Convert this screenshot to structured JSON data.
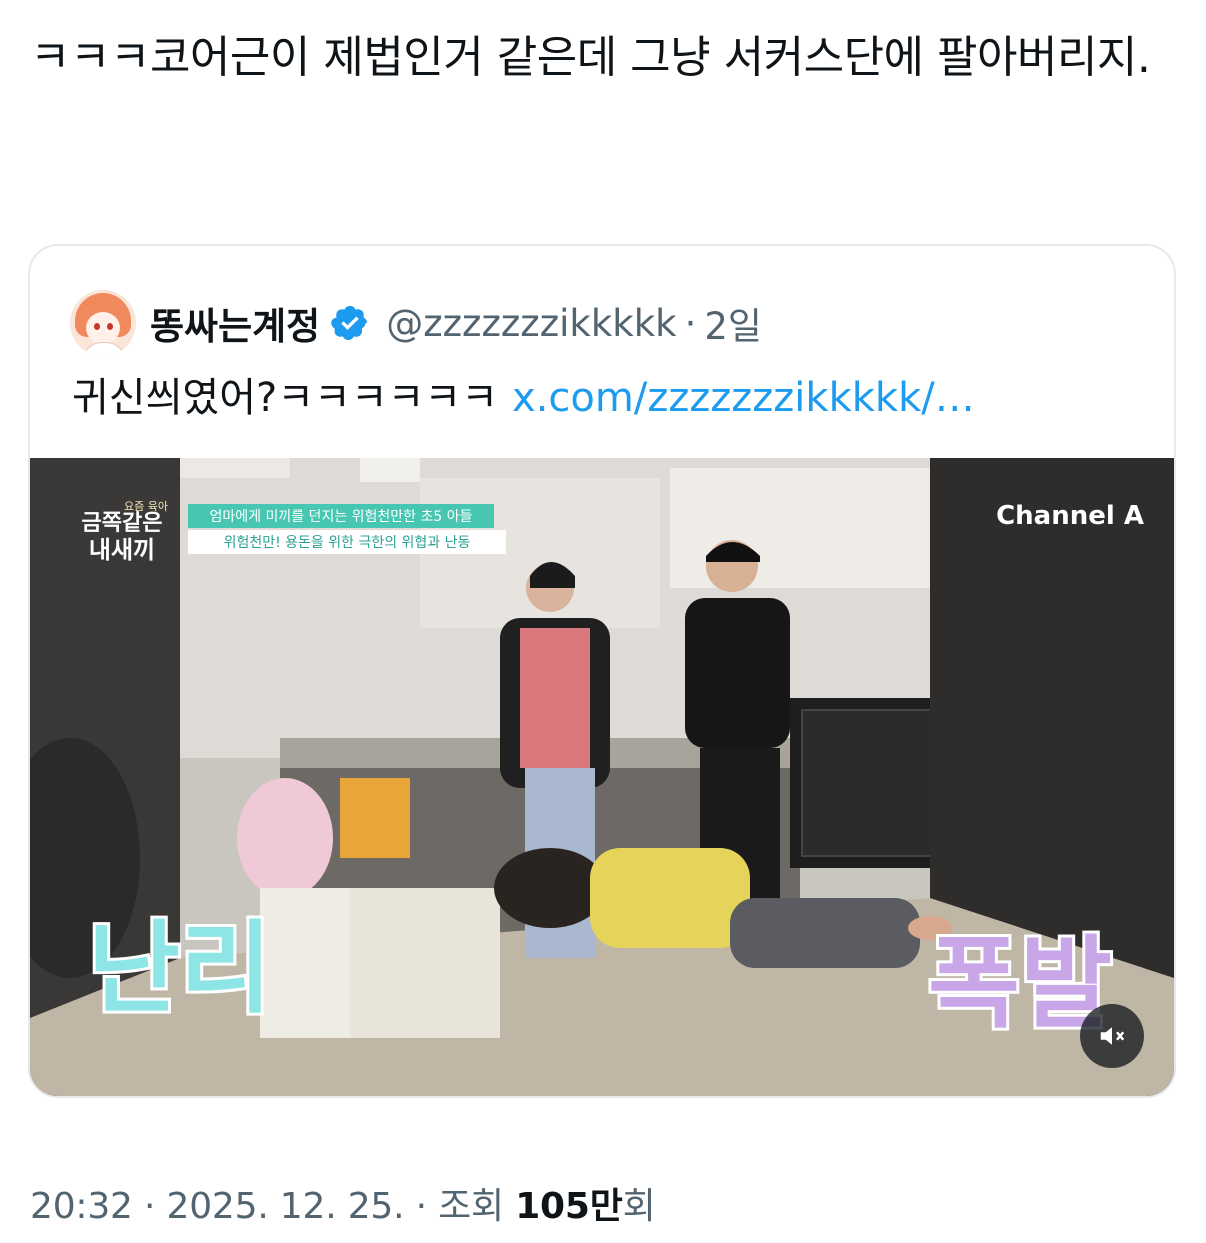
{
  "tweet": {
    "text": "ㅋㅋㅋ코어근이 제법인거 같은데 그냥 서커스단에 팔아버리지."
  },
  "quoted_tweet": {
    "display_name": "똥싸는계정",
    "verified": true,
    "handle": "@zzzzzzzikkkkk",
    "separator": "·",
    "age": "2일",
    "text": "귀신씌였어?ㅋㅋㅋㅋㅋㅋ",
    "link_text": "x.com/zzzzzzzikkkkk/…",
    "media": {
      "show_logo_small": "요즘 육아",
      "show_logo_line1": "금쪽같은",
      "show_logo_line2": "내새끼",
      "headline_1": "엄마에게 미끼를 던지는 위험천만한 초5 아들",
      "headline_2": "위험천만! 용돈을 위한 극한의 위협과 난동",
      "channel_logo": "Channel A",
      "caption_left": "난리",
      "caption_right": "폭발",
      "mute_icon": "speaker-muted-icon"
    }
  },
  "footer": {
    "time": "20:32",
    "sep1": "·",
    "date": "2025. 12. 25.",
    "sep2": "·",
    "views_label": "조회",
    "views_value": "105만",
    "views_suffix": "회"
  },
  "colors": {
    "text_primary": "#0f1419",
    "text_secondary": "#536471",
    "link": "#1d9bf0",
    "verified": "#1d9bf0",
    "card_border": "#e6e9ec"
  }
}
